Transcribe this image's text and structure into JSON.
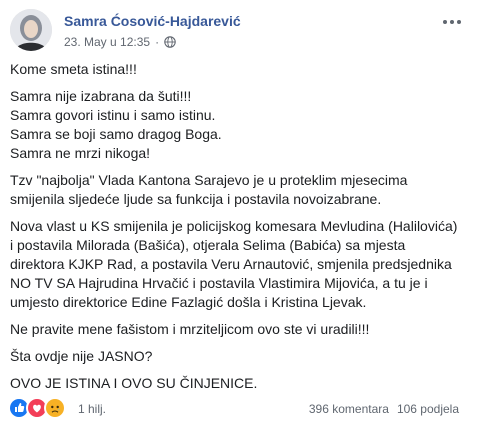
{
  "post": {
    "author": "Samra Ćosović-Hajdarević",
    "timestamp": "23. May u 12:35",
    "privacy_icon": "globe-icon",
    "paragraphs": [
      [
        "Kome smeta istina!!!"
      ],
      [
        "Samra nije izabrana da šuti!!!",
        "Samra govori istinu i samo istinu.",
        "Samra se boji samo dragog Boga.",
        "Samra ne mrzi nikoga!"
      ],
      [
        "Tzv \"najbolja\" Vlada Kantona Sarajevo je u proteklim mjesecima",
        "smijenila sljedeće ljude sa funkcija i postavila novoizabrane."
      ],
      [
        "Nova vlast u KS smijenila je policijskog komesara Mevludina (Halilovića)",
        "i postavila Milorada (Bašića), otjerala Selima (Babića) sa mjesta",
        "direktora KJKP Rad, a postavila Veru Arnautović, smjenila predsjednika",
        "NO TV SA Hajrudina Hrvačić i postavila Vlastimira Mijovića, a tu je i",
        "umjesto direktorice Edine Fazlagić došla i Kristina Ljevak."
      ],
      [
        "Ne pravite mene fašistom i mrziteljicom ovo ste vi uradili!!!"
      ],
      [
        "Šta ovdje nije JASNO?"
      ],
      [
        "OVO JE ISTINA I OVO SU ČINJENICE."
      ]
    ]
  },
  "footer": {
    "reactions": [
      "like",
      "love",
      "sad"
    ],
    "reaction_count": "1 hilj.",
    "comments": "396 komentara",
    "shares": "106 podjela"
  },
  "colors": {
    "author": "#385898",
    "meta": "#616770",
    "text": "#1c1e21",
    "like": "#1877f2",
    "love": "#f33e58",
    "sad": "#f7b125"
  }
}
